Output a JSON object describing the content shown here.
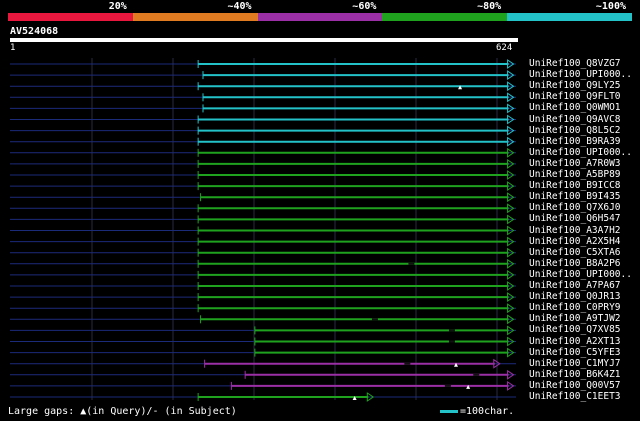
{
  "legend": [
    {
      "label": "20%",
      "color": "#e8173d"
    },
    {
      "label": "~40%",
      "color": "#e07b21"
    },
    {
      "label": "~60%",
      "color": "#9b2fa6"
    },
    {
      "label": "~80%",
      "color": "#1fa31f"
    },
    {
      "label": "~100%",
      "color": "#23c2c9"
    }
  ],
  "query": {
    "name": "AV524068",
    "start": "1",
    "end": "624",
    "length": 624
  },
  "hits": [
    {
      "name": "UniRef100_Q8VZG7",
      "start": 232,
      "end": 621,
      "color": "#23c2c9",
      "gaps": []
    },
    {
      "name": "UniRef100_UPI000..",
      "start": 238,
      "end": 621,
      "color": "#23c2c9",
      "gaps": []
    },
    {
      "name": "UniRef100_Q9LY25",
      "start": 232,
      "end": 621,
      "color": "#23c2c9",
      "gaps": [
        {
          "pos": 555,
          "type": "query"
        }
      ]
    },
    {
      "name": "UniRef100_Q9FLT0",
      "start": 238,
      "end": 621,
      "color": "#23c2c9",
      "gaps": []
    },
    {
      "name": "UniRef100_Q0WMO1",
      "start": 238,
      "end": 621,
      "color": "#23c2c9",
      "gaps": []
    },
    {
      "name": "UniRef100_Q9AVC8",
      "start": 232,
      "end": 621,
      "color": "#23c2c9",
      "gaps": []
    },
    {
      "name": "UniRef100_Q8L5C2",
      "start": 232,
      "end": 621,
      "color": "#23c2c9",
      "gaps": []
    },
    {
      "name": "UniRef100_B9RA39",
      "start": 232,
      "end": 621,
      "color": "#23c2c9",
      "gaps": []
    },
    {
      "name": "UniRef100_UPI000..",
      "start": 232,
      "end": 621,
      "color": "#1fa31f",
      "gaps": []
    },
    {
      "name": "UniRef100_A7R0W3",
      "start": 232,
      "end": 621,
      "color": "#1fa31f",
      "gaps": []
    },
    {
      "name": "UniRef100_A5BP89",
      "start": 232,
      "end": 621,
      "color": "#1fa31f",
      "gaps": []
    },
    {
      "name": "UniRef100_B9ICC8",
      "start": 232,
      "end": 621,
      "color": "#1fa31f",
      "gaps": []
    },
    {
      "name": "UniRef100_B9I435",
      "start": 235,
      "end": 621,
      "color": "#1fa31f",
      "gaps": []
    },
    {
      "name": "UniRef100_Q7X6J0",
      "start": 232,
      "end": 621,
      "color": "#1fa31f",
      "gaps": []
    },
    {
      "name": "UniRef100_Q6H547",
      "start": 232,
      "end": 621,
      "color": "#1fa31f",
      "gaps": []
    },
    {
      "name": "UniRef100_A3A7H2",
      "start": 232,
      "end": 621,
      "color": "#1fa31f",
      "gaps": []
    },
    {
      "name": "UniRef100_A2X5H4",
      "start": 232,
      "end": 621,
      "color": "#1fa31f",
      "gaps": []
    },
    {
      "name": "UniRef100_C5XTA6",
      "start": 232,
      "end": 621,
      "color": "#1fa31f",
      "gaps": []
    },
    {
      "name": "UniRef100_B8A2P6",
      "start": 232,
      "end": 621,
      "color": "#1fa31f",
      "gaps": [
        {
          "pos": 495,
          "type": "subject"
        }
      ]
    },
    {
      "name": "UniRef100_UPI000..",
      "start": 232,
      "end": 621,
      "color": "#1fa31f",
      "gaps": []
    },
    {
      "name": "UniRef100_A7PA67",
      "start": 232,
      "end": 621,
      "color": "#1fa31f",
      "gaps": []
    },
    {
      "name": "UniRef100_Q0JR13",
      "start": 232,
      "end": 621,
      "color": "#1fa31f",
      "gaps": []
    },
    {
      "name": "UniRef100_C0PRY9",
      "start": 232,
      "end": 621,
      "color": "#1fa31f",
      "gaps": []
    },
    {
      "name": "UniRef100_A9TJW2",
      "start": 235,
      "end": 621,
      "color": "#1fa31f",
      "gaps": [
        {
          "pos": 450,
          "type": "subject"
        }
      ]
    },
    {
      "name": "UniRef100_Q7XV85",
      "start": 302,
      "end": 621,
      "color": "#1fa31f",
      "gaps": [
        {
          "pos": 545,
          "type": "subject"
        }
      ]
    },
    {
      "name": "UniRef100_A2XT13",
      "start": 302,
      "end": 621,
      "color": "#1fa31f",
      "gaps": [
        {
          "pos": 545,
          "type": "subject"
        }
      ]
    },
    {
      "name": "UniRef100_C5YFE3",
      "start": 302,
      "end": 621,
      "color": "#1fa31f",
      "gaps": []
    },
    {
      "name": "UniRef100_C1MYJ7",
      "start": 240,
      "end": 604,
      "color": "#9b2fa6",
      "gaps": [
        {
          "pos": 490,
          "type": "subject"
        },
        {
          "pos": 550,
          "type": "query"
        }
      ]
    },
    {
      "name": "UniRef100_B6K4Z1",
      "start": 290,
      "end": 621,
      "color": "#9b2fa6",
      "gaps": [
        {
          "pos": 575,
          "type": "subject"
        }
      ]
    },
    {
      "name": "UniRef100_Q00V57",
      "start": 273,
      "end": 621,
      "color": "#9b2fa6",
      "gaps": [
        {
          "pos": 540,
          "type": "subject"
        },
        {
          "pos": 565,
          "type": "query"
        }
      ]
    },
    {
      "name": "UniRef100_C1EET3",
      "start": 232,
      "end": 448,
      "color": "#1fa31f",
      "gaps": [
        {
          "pos": 425,
          "type": "query"
        }
      ]
    }
  ],
  "footer": {
    "gap_note": "Large gaps: ▲(in Query)/- (in Subject)",
    "scale_note": "=100char."
  }
}
